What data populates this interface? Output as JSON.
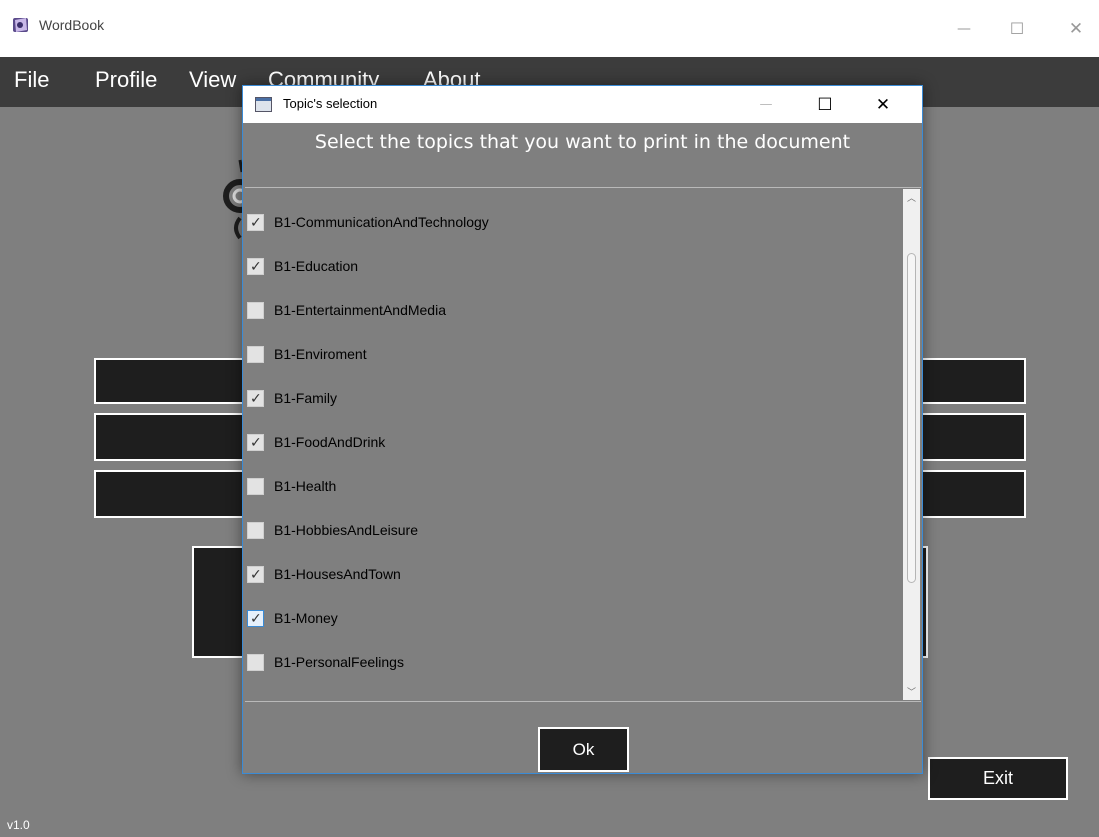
{
  "main_window": {
    "title": "WordBook",
    "controls": {
      "minimize": "—",
      "maximize": "☐",
      "close": "✕"
    }
  },
  "menu": {
    "items": [
      {
        "label": "File"
      },
      {
        "label": "Profile"
      },
      {
        "label": "View"
      },
      {
        "label": "Community"
      },
      {
        "label": "About"
      }
    ]
  },
  "footer": {
    "version": "v1.0",
    "exit_label": "Exit"
  },
  "dialog": {
    "title": "Topic's selection",
    "heading": "Select the topics that you want to print in the document",
    "controls": {
      "minimize": "—",
      "maximize": "☐",
      "close": "✕"
    },
    "topics": [
      {
        "label": "B1-CommunicationAndTechnology",
        "checked": true
      },
      {
        "label": "B1-Education",
        "checked": true
      },
      {
        "label": "B1-EntertainmentAndMedia",
        "checked": false
      },
      {
        "label": "B1-Enviroment",
        "checked": false
      },
      {
        "label": "B1-Family",
        "checked": true
      },
      {
        "label": "B1-FoodAndDrink",
        "checked": true
      },
      {
        "label": "B1-Health",
        "checked": false
      },
      {
        "label": "B1-HobbiesAndLeisure",
        "checked": false
      },
      {
        "label": "B1-HousesAndTown",
        "checked": true
      },
      {
        "label": "B1-Money",
        "checked": true,
        "focused": true
      },
      {
        "label": "B1-PersonalFeelings",
        "checked": false
      }
    ],
    "ok_label": "Ok"
  },
  "colors": {
    "background": "#7f7f7f",
    "menubar": "#3c3c3c",
    "button_fill": "#1e1e1e",
    "dialog_border": "#3a8bd6"
  }
}
